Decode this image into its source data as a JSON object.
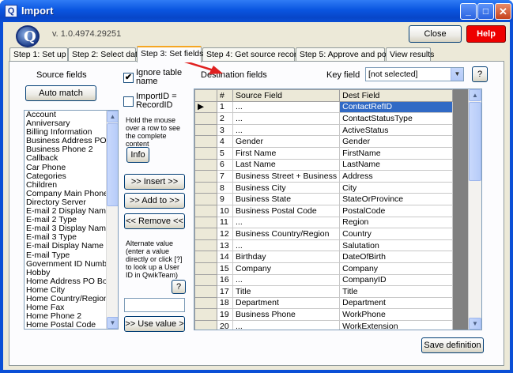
{
  "window": {
    "title": "Import",
    "icon_glyph": "Q"
  },
  "header": {
    "logo_glyph": "Q",
    "version": "v. 1.0.4974.29251",
    "close_label": "Close",
    "help_label": "Help"
  },
  "tabs": [
    {
      "label": "Step 1: Set up"
    },
    {
      "label": "Step 2: Select data"
    },
    {
      "label": "Step 3: Set fields"
    },
    {
      "label": "Step 4: Get source records"
    },
    {
      "label": "Step 5: Approve and post"
    },
    {
      "label": "View results"
    }
  ],
  "source": {
    "heading": "Source fields",
    "auto_match_label": "Auto match",
    "items": [
      "Account",
      "Anniversary",
      "Billing Information",
      "Business Address PO Box",
      "Business Phone 2",
      "Callback",
      "Car Phone",
      "Categories",
      "Children",
      "Company Main Phone",
      "Directory Server",
      "E-mail 2 Display Name",
      "E-mail 2 Type",
      "E-mail 3 Display Name",
      "E-mail 3 Type",
      "E-mail Display Name",
      "E-mail Type",
      "Government ID Number",
      "Hobby",
      "Home Address PO Box",
      "Home City",
      "Home Country/Region",
      "Home Fax",
      "Home Phone 2",
      "Home Postal Code"
    ]
  },
  "options": {
    "ignore_table_name_label": "Ignore table name",
    "ignore_table_name_checked": true,
    "importid_label": "ImportID = RecordID",
    "importid_checked": false,
    "hover_hint": "Hold the mouse over a row to see the complete content",
    "info_label": "Info",
    "insert_label": ">> Insert >>",
    "add_to_label": ">> Add to >>",
    "remove_label": "<< Remove <<",
    "alt_value_hint": "Alternate value (enter a value directly or click [?] to look up a User ID in QwikTeam)",
    "question_label": "?",
    "alt_value": "",
    "use_value_label": ">> Use value >"
  },
  "destination": {
    "heading": "Destination fields",
    "key_field_label": "Key field",
    "key_field_value": "[not selected]",
    "key_help_label": "?",
    "columns": [
      "#",
      "Source Field",
      "Dest Field"
    ],
    "current_row_marker": "▶",
    "rows": [
      {
        "n": "1",
        "src": "...",
        "dest": "ContactRefID"
      },
      {
        "n": "2",
        "src": "...",
        "dest": "ContactStatusType"
      },
      {
        "n": "3",
        "src": "...",
        "dest": "ActiveStatus"
      },
      {
        "n": "4",
        "src": "Gender",
        "dest": "Gender"
      },
      {
        "n": "5",
        "src": "First Name",
        "dest": "FirstName"
      },
      {
        "n": "6",
        "src": "Last Name",
        "dest": "LastName"
      },
      {
        "n": "7",
        "src": "Business Street + Business",
        "dest": "Address"
      },
      {
        "n": "8",
        "src": "Business City",
        "dest": "City"
      },
      {
        "n": "9",
        "src": "Business State",
        "dest": "StateOrProvince"
      },
      {
        "n": "10",
        "src": "Business Postal Code",
        "dest": "PostalCode"
      },
      {
        "n": "11",
        "src": "...",
        "dest": "Region"
      },
      {
        "n": "12",
        "src": "Business Country/Region",
        "dest": "Country"
      },
      {
        "n": "13",
        "src": "...",
        "dest": "Salutation"
      },
      {
        "n": "14",
        "src": "Birthday",
        "dest": "DateOfBirth"
      },
      {
        "n": "15",
        "src": "Company",
        "dest": "Company"
      },
      {
        "n": "16",
        "src": "...",
        "dest": "CompanyID"
      },
      {
        "n": "17",
        "src": "Title",
        "dest": "Title"
      },
      {
        "n": "18",
        "src": "Department",
        "dest": "Department"
      },
      {
        "n": "19",
        "src": "Business Phone",
        "dest": "WorkPhone"
      },
      {
        "n": "20",
        "src": "...",
        "dest": "WorkExtension"
      }
    ]
  },
  "footer": {
    "save_definition_label": "Save definition"
  },
  "colors": {
    "accent_red": "#e02020",
    "selection": "#316ac5",
    "help_bg": "#ee0000"
  },
  "icons": {
    "minimize": "minimize-icon",
    "maximize": "maximize-icon",
    "close": "close-icon",
    "arrow": "red-arrow-annotation"
  }
}
